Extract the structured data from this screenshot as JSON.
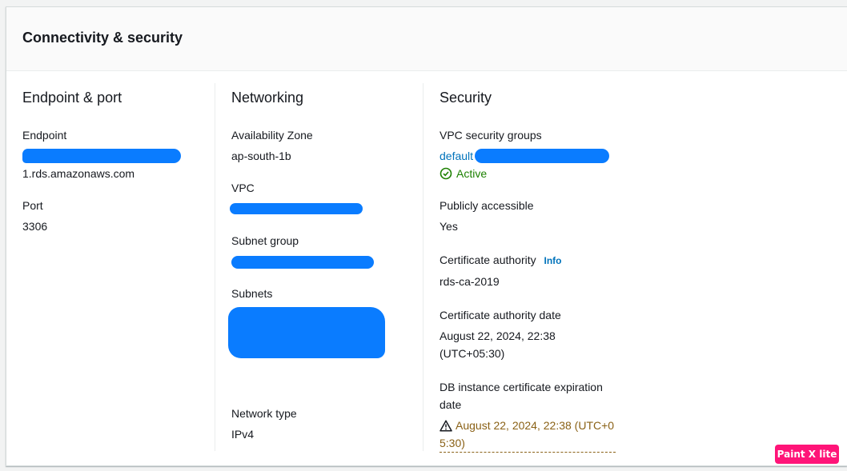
{
  "panel": {
    "title": "Connectivity & security"
  },
  "endpoint_col": {
    "title": "Endpoint & port",
    "endpoint_label": "Endpoint",
    "endpoint_value": "1.rds.amazonaws.com",
    "port_label": "Port",
    "port_value": "3306"
  },
  "networking_col": {
    "title": "Networking",
    "az_label": "Availability Zone",
    "az_value": "ap-south-1b",
    "vpc_label": "VPC",
    "subnet_group_label": "Subnet group",
    "subnets_label": "Subnets",
    "network_type_label": "Network type",
    "network_type_value": "IPv4"
  },
  "security_col": {
    "title": "Security",
    "vpc_sg_label": "VPC security groups",
    "vpc_sg_link": "default",
    "vpc_sg_status": "Active",
    "public_label": "Publicly accessible",
    "public_value": "Yes",
    "ca_label": "Certificate authority",
    "ca_info": "Info",
    "ca_value": "rds-ca-2019",
    "ca_date_label": "Certificate authority date",
    "ca_date_line1": "August 22, 2024, 22:38",
    "ca_date_line2": "(UTC+05:30)",
    "expiry_label_line1": "DB instance certificate expiration",
    "expiry_label_line2": "date",
    "expiry_line1": "August 22, 2024, 22:38 (UTC+0",
    "expiry_line2": "5:30)"
  },
  "overlay": {
    "badge": "Paint X lite"
  },
  "colors": {
    "redaction": "#0a7cff",
    "link": "#0073bb",
    "success": "#1d8102",
    "warning": "#8a6116"
  }
}
